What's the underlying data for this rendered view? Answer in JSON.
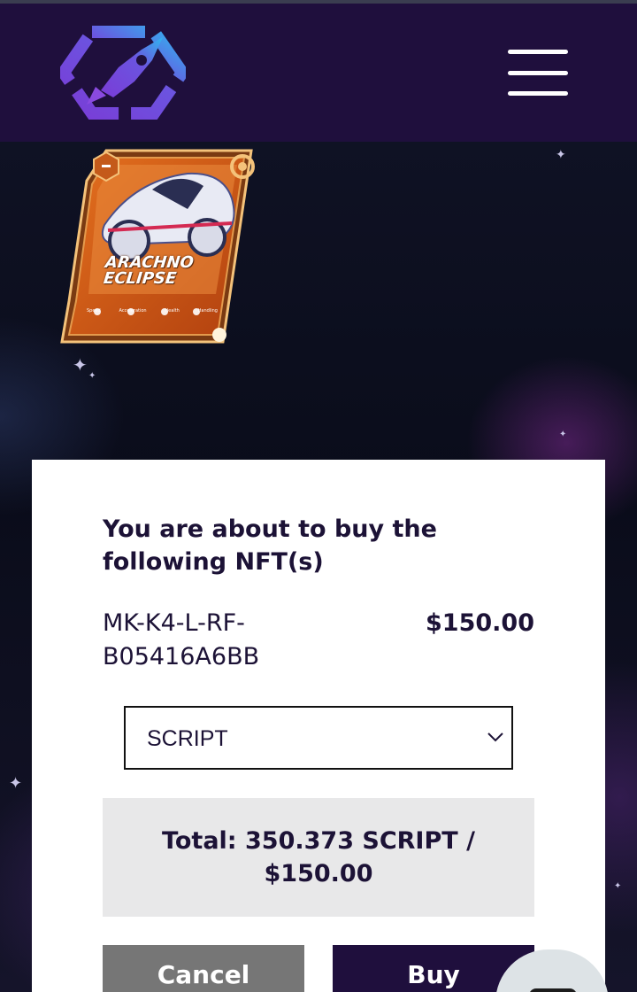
{
  "header": {
    "logo_icon": "rocket-hexagon-logo",
    "menu_icon": "hamburger-menu-icon"
  },
  "nft_card": {
    "name_line1": "ARACHNO",
    "name_line2": "ECLIPSE",
    "stats": [
      "Speed",
      "Acceleration",
      "Health",
      "Handling"
    ]
  },
  "modal": {
    "heading": "You are about to buy the following NFT(s)",
    "item": {
      "id": "MK-K4-L-RF-B05416A6BB",
      "price": "$150.00"
    },
    "currency_select": {
      "selected": "SCRIPT"
    },
    "total": "Total: 350.373 SCRIPT / $150.00",
    "cancel_label": "Cancel",
    "buy_label": "Buy"
  },
  "colors": {
    "header_bg": "#1f0f3d",
    "text_dark": "#1c1236",
    "cancel_bg": "#767676",
    "buy_bg": "#1f0f3d",
    "total_bg": "#e8e8e9"
  }
}
